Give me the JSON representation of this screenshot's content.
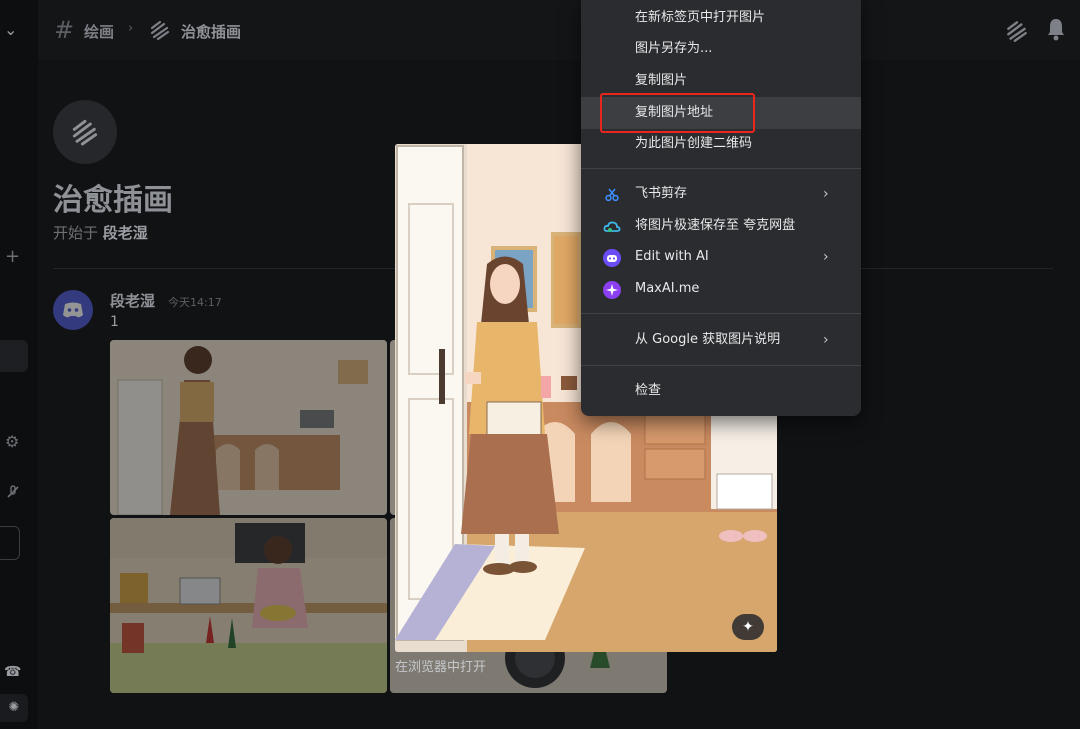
{
  "header": {
    "channel": "绘画",
    "thread": "治愈插画"
  },
  "thread_intro": {
    "title": "治愈插画",
    "started_prefix": "开始于",
    "started_by": "段老湿"
  },
  "message": {
    "author": "段老湿",
    "timestamp": "今天14:17",
    "text": "1"
  },
  "viewer": {
    "open_in_browser": "在浏览器中打开"
  },
  "context_menu": {
    "items": [
      {
        "label": "在新标签页中打开图片"
      },
      {
        "label": "图片另存为..."
      },
      {
        "label": "复制图片"
      },
      {
        "label": "复制图片地址",
        "highlighted": true
      },
      {
        "label": "为此图片创建二维码"
      },
      {
        "label": "飞书剪存",
        "icon": "scissors-icon",
        "submenu": true
      },
      {
        "label": "将图片极速保存至 夸克网盘",
        "icon": "cloud-icon"
      },
      {
        "label": "Edit with AI",
        "icon": "ai-bot-icon",
        "submenu": true
      },
      {
        "label": "MaxAI.me",
        "icon": "sparkle-icon"
      },
      {
        "label": "从 Google 获取图片说明",
        "submenu": true
      },
      {
        "label": "检查"
      }
    ]
  },
  "colors": {
    "highlight_box": "#e8261e",
    "menu_bg": "#2b2c2f",
    "app_bg": "#111214"
  }
}
